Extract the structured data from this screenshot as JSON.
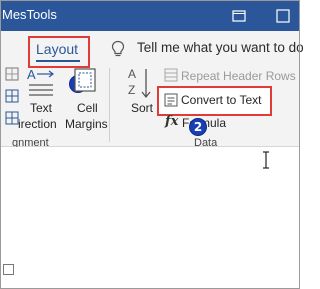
{
  "titlebar": {
    "title": "MesTools",
    "restore_icon": "restore-icon",
    "window_icon": "window-icon",
    "bg_color": "#2b579a"
  },
  "ribbon": {
    "tabs": {
      "layout_label": "Layout"
    },
    "tellme": {
      "text": "Tell me what you want to do",
      "icon": "lightbulb-icon"
    },
    "alignment_group": {
      "text_direction_label_line1": "Text",
      "text_direction_label_line2": "irection",
      "cell_margins_label_line1": "Cell",
      "cell_margins_label_line2": "Margins",
      "group_label": "gnment"
    },
    "data_group": {
      "sort_label": "Sort",
      "repeat_header_rows_label": "Repeat Header Rows",
      "convert_to_text_label": "Convert to Text",
      "formula_label": "Formula",
      "group_label": "Data"
    }
  },
  "annotations": {
    "badge_1": "1",
    "badge_2": "2",
    "highlight_color": "#e03b3b",
    "badge_color": "#1a3fb5"
  }
}
